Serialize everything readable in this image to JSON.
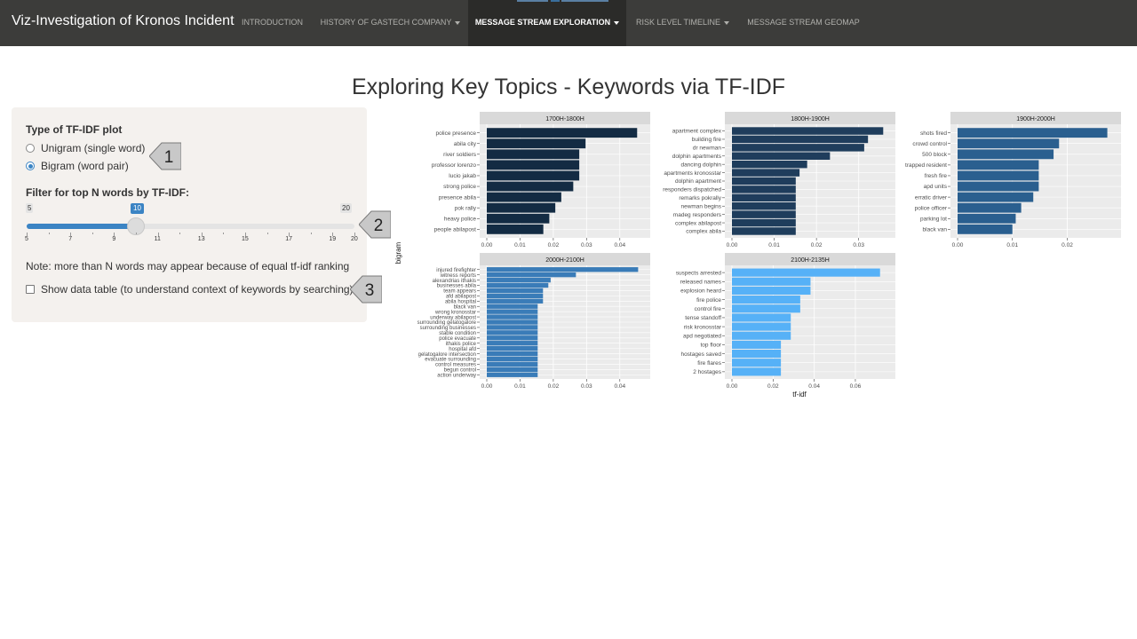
{
  "navbar": {
    "brand": "Viz-Investigation of Kronos Incident",
    "items": [
      {
        "label": "INTRODUCTION",
        "dropdown": false,
        "active": false
      },
      {
        "label": "HISTORY OF GASTECH COMPANY",
        "dropdown": true,
        "active": false
      },
      {
        "label": "MESSAGE STREAM EXPLORATION",
        "dropdown": true,
        "active": true
      },
      {
        "label": "RISK LEVEL TIMELINE",
        "dropdown": true,
        "active": false
      },
      {
        "label": "MESSAGE STREAM GEOMAP",
        "dropdown": false,
        "active": false
      }
    ]
  },
  "page": {
    "title": "Exploring Key Topics - Keywords via TF-IDF"
  },
  "controls": {
    "plot_type_label": "Type of TF-IDF plot",
    "options": [
      {
        "label": "Unigram (single word)",
        "selected": false
      },
      {
        "label": "Bigram (word pair)",
        "selected": true
      }
    ],
    "slider": {
      "label": "Filter for top N words by TF-IDF:",
      "min": 5,
      "max": 20,
      "value": 10,
      "min_label": "5",
      "max_label": "20",
      "value_label": "10",
      "ticks": [
        "5",
        "7",
        "9",
        "11",
        "13",
        "15",
        "17",
        "19",
        "20"
      ]
    },
    "note": "Note: more than N words may appear because of equal tf-idf ranking",
    "show_table_label": "Show data table (to understand context of keywords by searching)",
    "show_table_checked": false
  },
  "callouts": [
    "1",
    "2",
    "3"
  ],
  "colors": {
    "accent": "#3b84c4",
    "navbar": "#3c3c3a",
    "panel": "#f4f1ee",
    "callout": "#c8c8c8"
  },
  "chart_data": {
    "type": "bar",
    "orientation": "horizontal",
    "facet_type": "facet_wrap",
    "xlabel": "tf-idf",
    "ylabel": "bigram",
    "panels": [
      {
        "title": "1700H-1800H",
        "color": "#132b43",
        "xticks": [
          "0.00",
          "0.01",
          "0.02",
          "0.03",
          "0.04"
        ],
        "xlim": [
          0,
          0.047
        ],
        "categories": [
          "police presence",
          "abila city",
          "river soldiers",
          "professor lorenzo",
          "lucio jakab",
          "strong police",
          "presence abila",
          "pok rally",
          "heavy police",
          "people abilapost"
        ],
        "values": [
          0.0452,
          0.0297,
          0.0278,
          0.0278,
          0.0278,
          0.026,
          0.0224,
          0.0206,
          0.0188,
          0.017
        ]
      },
      {
        "title": "1800H-1900H",
        "color": "#1f3d5c",
        "xticks": [
          "0.00",
          "0.01",
          "0.02",
          "0.03"
        ],
        "xlim": [
          0,
          0.037
        ],
        "categories": [
          "apartment complex",
          "building fire",
          "dr newman",
          "dolphin apartments",
          "dancing dolphin",
          "apartments kronosstar",
          "dolphin apartment",
          "responders dispatched",
          "remarks pokrally",
          "newman begins",
          "madeg responders",
          "complex abilapost",
          "complex abila"
        ],
        "values": [
          0.0358,
          0.0322,
          0.0313,
          0.0232,
          0.0178,
          0.016,
          0.0151,
          0.0151,
          0.0151,
          0.0151,
          0.0151,
          0.0151,
          0.0151
        ]
      },
      {
        "title": "1900H-2000H",
        "color": "#2a5f8f",
        "xticks": [
          "0.00",
          "0.01",
          "0.02"
        ],
        "xlim": [
          0,
          0.0285
        ],
        "categories": [
          "shots fired",
          "crowd control",
          "500 block",
          "trapped resident",
          "fresh fire",
          "apd units",
          "erratic driver",
          "police officer",
          "parking lot",
          "black van"
        ],
        "values": [
          0.0273,
          0.0185,
          0.0175,
          0.0148,
          0.0148,
          0.0148,
          0.0138,
          0.0116,
          0.0106,
          0.01
        ]
      },
      {
        "title": "2000H-2100H",
        "color": "#3a7cb8",
        "xticks": [
          "0.00",
          "0.01",
          "0.02",
          "0.03",
          "0.04"
        ],
        "xlim": [
          0,
          0.047
        ],
        "categories": [
          "injured firefighter",
          "witness reports",
          "alexandrias ithakis",
          "businesses abila",
          "team appears",
          "afd abilapost",
          "abila hospital",
          "black van",
          "wrong kronosstar",
          "underway abilapost",
          "surrounding gelatogalore",
          "surrounding businesses",
          "stable condition",
          "police evacuate",
          "ithakis police",
          "hospital afd",
          "gelatogalore intersection",
          "evacuate surrounding",
          "control measures",
          "begun control",
          "action underway"
        ],
        "values": [
          0.0455,
          0.0268,
          0.0192,
          0.0185,
          0.0169,
          0.0169,
          0.0169,
          0.0153,
          0.0153,
          0.0153,
          0.0153,
          0.0153,
          0.0153,
          0.0153,
          0.0153,
          0.0153,
          0.0153,
          0.0153,
          0.0153,
          0.0153,
          0.0153
        ]
      },
      {
        "title": "2100H-2135H",
        "color": "#56b1f7",
        "xticks": [
          "0.00",
          "0.02",
          "0.04",
          "0.06"
        ],
        "xlim": [
          0,
          0.076
        ],
        "categories": [
          "suspects arrested",
          "released names",
          "explosion heard",
          "fire police",
          "control fire",
          "tense standoff",
          "risk kronosstar",
          "apd negotiated",
          "top floor",
          "hostages saved",
          "fire flares",
          "2 hostages"
        ],
        "values": [
          0.072,
          0.0382,
          0.0382,
          0.0332,
          0.0332,
          0.0286,
          0.0286,
          0.0286,
          0.0238,
          0.0238,
          0.0238,
          0.0238
        ]
      }
    ]
  }
}
